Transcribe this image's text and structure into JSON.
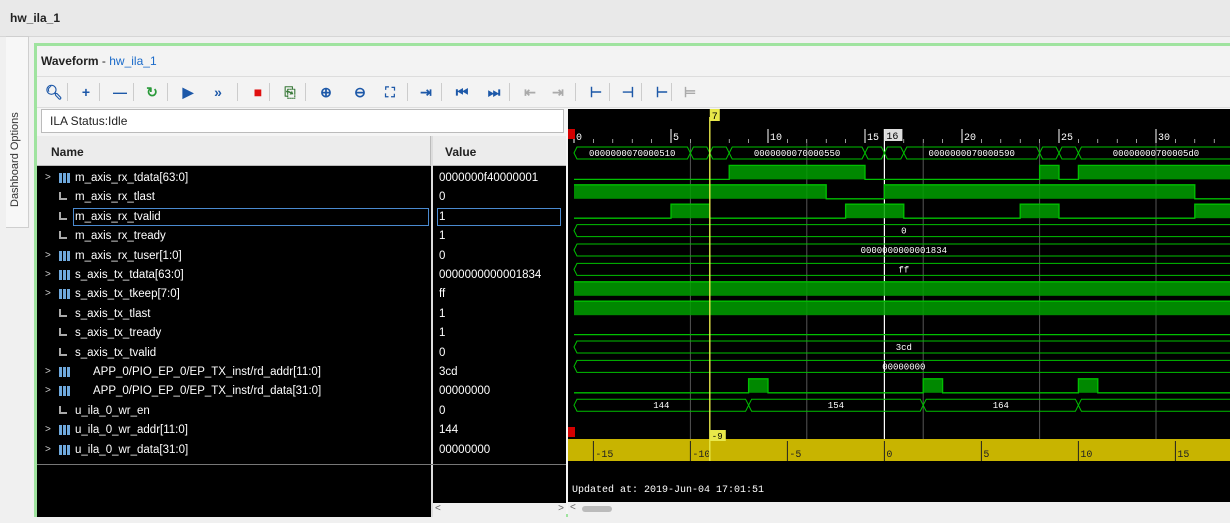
{
  "window": {
    "title": "hw_ila_1"
  },
  "side_tab": {
    "label": "Dashboard Options"
  },
  "panel": {
    "title": "Waveform",
    "title_sep": " - ",
    "subtitle": "hw_ila_1"
  },
  "toolbar": [
    {
      "icon": "search-icon",
      "glyph": "🔍︎"
    },
    {
      "icon": "plus-icon",
      "glyph": "+"
    },
    {
      "icon": "minus-icon",
      "glyph": "—"
    },
    {
      "icon": "refresh-icon",
      "glyph": "↻"
    },
    {
      "icon": "run-icon",
      "glyph": "▶"
    },
    {
      "icon": "run-immediate-icon",
      "glyph": "»"
    },
    {
      "icon": "stop-icon",
      "glyph": "■"
    },
    {
      "icon": "export-icon",
      "glyph": "⎘"
    },
    {
      "icon": "zoom-in-icon",
      "glyph": "⊕"
    },
    {
      "icon": "zoom-out-icon",
      "glyph": "⊖"
    },
    {
      "icon": "zoom-fit-icon",
      "glyph": "⛶"
    },
    {
      "icon": "goto-cursor-icon",
      "glyph": "⇥"
    },
    {
      "icon": "goto-start-icon",
      "glyph": "⏮"
    },
    {
      "icon": "goto-end-icon",
      "glyph": "⏭"
    },
    {
      "icon": "prev-transition-icon",
      "glyph": "⇤"
    },
    {
      "icon": "next-transition-icon",
      "glyph": "⇥"
    },
    {
      "icon": "add-marker-icon",
      "glyph": "⊢"
    },
    {
      "icon": "prev-marker-icon",
      "glyph": "⊣"
    },
    {
      "icon": "next-marker-icon",
      "glyph": "⊢"
    },
    {
      "icon": "swap-cursors-icon",
      "glyph": "⊨"
    }
  ],
  "status": "ILA Status:Idle",
  "columns": {
    "name": "Name",
    "value": "Value"
  },
  "signals": [
    {
      "name": "m_axis_rx_tdata[63:0]",
      "value": "0000000f40000001",
      "expand": true,
      "kind": "bus"
    },
    {
      "name": "m_axis_rx_tlast",
      "value": "0",
      "expand": false,
      "kind": "bit"
    },
    {
      "name": "m_axis_rx_tvalid",
      "value": "1",
      "expand": false,
      "kind": "bit",
      "selected": true
    },
    {
      "name": "m_axis_rx_tready",
      "value": "1",
      "expand": false,
      "kind": "bit"
    },
    {
      "name": "m_axis_rx_tuser[1:0]",
      "value": "0",
      "expand": true,
      "kind": "bus"
    },
    {
      "name": "s_axis_tx_tdata[63:0]",
      "value": "0000000000001834",
      "expand": true,
      "kind": "bus"
    },
    {
      "name": "s_axis_tx_tkeep[7:0]",
      "value": "ff",
      "expand": true,
      "kind": "bus"
    },
    {
      "name": "s_axis_tx_tlast",
      "value": "1",
      "expand": false,
      "kind": "bit"
    },
    {
      "name": "s_axis_tx_tready",
      "value": "1",
      "expand": false,
      "kind": "bit"
    },
    {
      "name": "s_axis_tx_tvalid",
      "value": "0",
      "expand": false,
      "kind": "bit"
    },
    {
      "name": "APP_0/PIO_EP_0/EP_TX_inst/rd_addr[11:0]",
      "value": "3cd",
      "expand": true,
      "kind": "bus",
      "indent": true
    },
    {
      "name": "APP_0/PIO_EP_0/EP_TX_inst/rd_data[31:0]",
      "value": "00000000",
      "expand": true,
      "kind": "bus",
      "indent": true
    },
    {
      "name": "u_ila_0_wr_en",
      "value": "0",
      "expand": false,
      "kind": "bit"
    },
    {
      "name": "u_ila_0_wr_addr[11:0]",
      "value": "144",
      "expand": true,
      "kind": "bus"
    },
    {
      "name": "u_ila_0_wr_data[31:0]",
      "value": "00000000",
      "expand": true,
      "kind": "bus"
    }
  ],
  "timeline": {
    "top_ticks": [
      "0",
      "5",
      "10",
      "15",
      "20",
      "25",
      "30"
    ],
    "bottom_ticks": [
      "-15",
      "-10",
      "-5",
      "0",
      "5",
      "10",
      "15"
    ],
    "cursor_label": "7",
    "trigger_label": "16",
    "cursor_delta": "-9",
    "marker_T": "T"
  },
  "waves": {
    "rx_tdata": [
      "0000000070000510",
      "0000000070000550",
      "0000000070000590",
      "00000000700005d0"
    ],
    "rx_tuser": "0",
    "tx_tdata": "0000000000001834",
    "tx_tkeep": "ff",
    "rd_addr": "3cd",
    "rd_data": "00000000",
    "wr_addr": [
      "144",
      "154",
      "164"
    ]
  },
  "footer": "Updated at: 2019-Jun-04 17:01:51",
  "colors": {
    "wave": "#00c000",
    "wave_fill": "#00a000",
    "cursor": "#e8e84a",
    "trigger": "#ffffff",
    "marker": "#d40000",
    "bottom_bar": "#c8b400"
  }
}
